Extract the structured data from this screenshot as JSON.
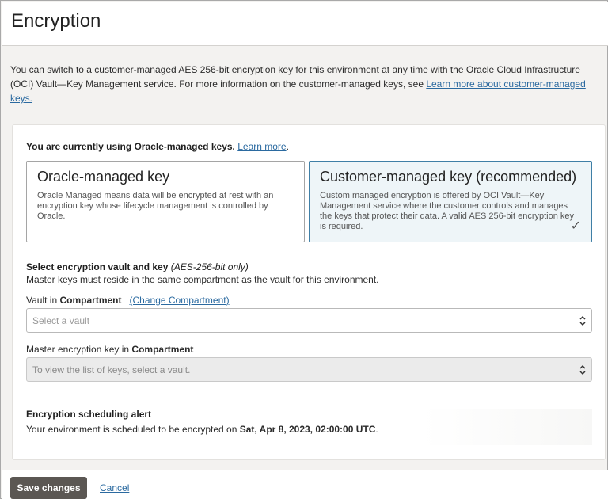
{
  "header": {
    "title": "Encryption"
  },
  "intro": {
    "text": "You can switch to a customer-managed AES 256-bit encryption key for this environment at any time with the Oracle Cloud Infrastructure (OCI) Vault—Key Management service. For more information on the customer-managed keys, see ",
    "link": "Learn more about customer-managed keys."
  },
  "current": {
    "text": "You are currently using Oracle-managed keys.",
    "link": "Learn more",
    "suffix": "."
  },
  "cards": {
    "oracle": {
      "title": "Oracle-managed key",
      "description": "Oracle Managed means data will be encrypted at rest with an encryption key whose lifecycle management is controlled by Oracle."
    },
    "customer": {
      "title": "Customer-managed key (recommended)",
      "description": "Custom managed encryption is offered by OCI Vault—Key Management service where the customer controls and manages the keys that protect their data. A valid AES 256-bit encryption key is required.",
      "check": "✓"
    }
  },
  "vault_section": {
    "title": "Select encryption vault and key",
    "title_note": "(AES-256-bit only)",
    "subtitle": "Master keys must reside in the same compartment as the vault for this environment."
  },
  "vault_field": {
    "label_prefix": "Vault in",
    "label_bold": "Compartment",
    "change_link": "(Change Compartment)",
    "placeholder": "Select a vault"
  },
  "key_field": {
    "label_prefix": "Master encryption key in",
    "label_bold": "Compartment",
    "placeholder": "To view the list of keys, select a vault."
  },
  "alert": {
    "title": "Encryption scheduling alert",
    "text": "Your environment is scheduled to be encrypted on",
    "date": "Sat, Apr 8, 2023, 02:00:00 UTC",
    "suffix": "."
  },
  "footer": {
    "save_label": "Save changes",
    "cancel_label": "Cancel"
  }
}
